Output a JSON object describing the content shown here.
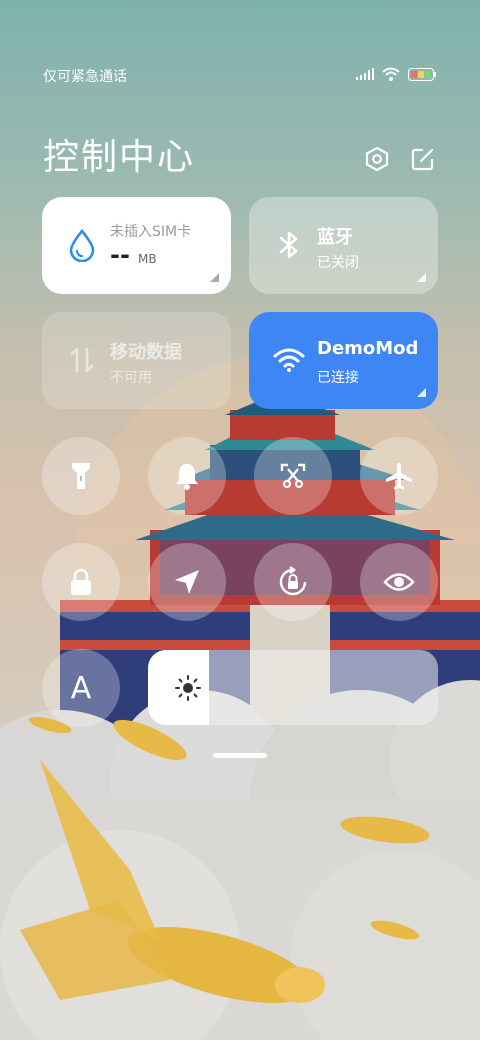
{
  "status_bar": {
    "carrier_text": "仅可紧急通话",
    "icons": [
      "signal-icon",
      "wifi-icon",
      "battery-icon"
    ],
    "battery_colors": [
      "#f26b6b",
      "#f5d84a",
      "#7fd36b"
    ]
  },
  "header": {
    "title": "控制中心",
    "settings_icon": "settings-hexagon-icon",
    "edit_icon": "edit-icon"
  },
  "tiles": {
    "data_usage": {
      "label": "未插入SIM卡",
      "value": "--",
      "unit": "MB",
      "icon": "water-drop-icon",
      "accent": "#2f8fe8"
    },
    "bluetooth": {
      "label": "蓝牙",
      "status": "已关闭",
      "icon": "bluetooth-icon"
    },
    "mobile_data": {
      "label": "移动数据",
      "status": "不可用",
      "icon": "data-arrows-icon"
    },
    "wifi": {
      "label": "DemoMod",
      "status": "已连接",
      "icon": "wifi-icon",
      "accent": "#3f86f5"
    }
  },
  "toggles": [
    {
      "icon": "flashlight-icon"
    },
    {
      "icon": "bell-icon"
    },
    {
      "icon": "screenshot-icon"
    },
    {
      "icon": "airplane-icon"
    },
    {
      "icon": "lock-icon"
    },
    {
      "icon": "location-icon"
    },
    {
      "icon": "rotation-lock-icon"
    },
    {
      "icon": "eye-icon"
    }
  ],
  "auto_brightness": {
    "label": "A"
  },
  "brightness": {
    "icon": "sun-icon",
    "level": 0.21
  }
}
